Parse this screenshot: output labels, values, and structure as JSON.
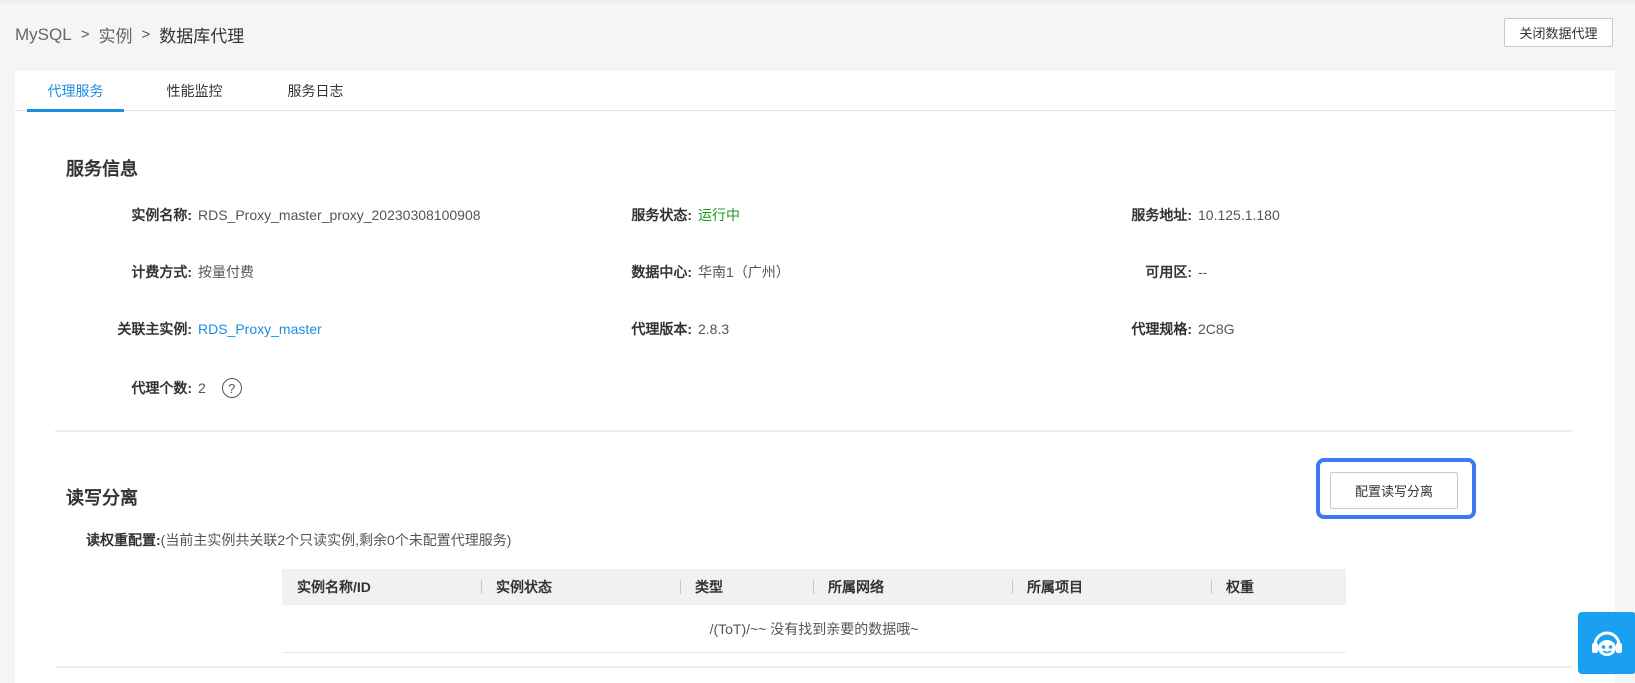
{
  "breadcrumb": {
    "items": [
      "MySQL",
      "实例",
      "数据库代理"
    ],
    "separator": ">"
  },
  "header": {
    "close_proxy_label": "关闭数据代理"
  },
  "tabs": [
    {
      "label": "代理服务",
      "active": true
    },
    {
      "label": "性能监控",
      "active": false
    },
    {
      "label": "服务日志",
      "active": false
    }
  ],
  "service_info": {
    "title": "服务信息",
    "instance_name_label": "实例名称:",
    "instance_name_value": "RDS_Proxy_master_proxy_20230308100908",
    "status_label": "服务状态:",
    "status_value": "运行中",
    "address_label": "服务地址:",
    "address_value": "10.125.1.180",
    "billing_label": "计费方式:",
    "billing_value": "按量付费",
    "datacenter_label": "数据中心:",
    "datacenter_value": "华南1（广州）",
    "zone_label": "可用区:",
    "zone_value": "--",
    "master_label": "关联主实例:",
    "master_value": "RDS_Proxy_master",
    "version_label": "代理版本:",
    "version_value": "2.8.3",
    "spec_label": "代理规格:",
    "spec_value": "2C8G",
    "count_label": "代理个数:",
    "count_value": "2",
    "help_glyph": "?"
  },
  "rw_split": {
    "title": "读写分离",
    "config_button_label": "配置读写分离",
    "weight_label": "读权重配置:",
    "weight_note": "(当前主实例共关联2个只读实例,剩余0个未配置代理服务)",
    "columns": [
      "实例名称/ID",
      "实例状态",
      "类型",
      "所属网络",
      "所属项目",
      "权重"
    ],
    "empty_text": "/(ToT)/~~ 没有找到亲要的数据哦~"
  },
  "icons": {
    "help": "question-circle-icon",
    "chat": "customer-service-icon"
  },
  "colors": {
    "accent": "#1b8fe0",
    "status_running": "#1a9a1a",
    "focus_ring": "#3f78f0",
    "chat_button": "#1aa0f0"
  }
}
